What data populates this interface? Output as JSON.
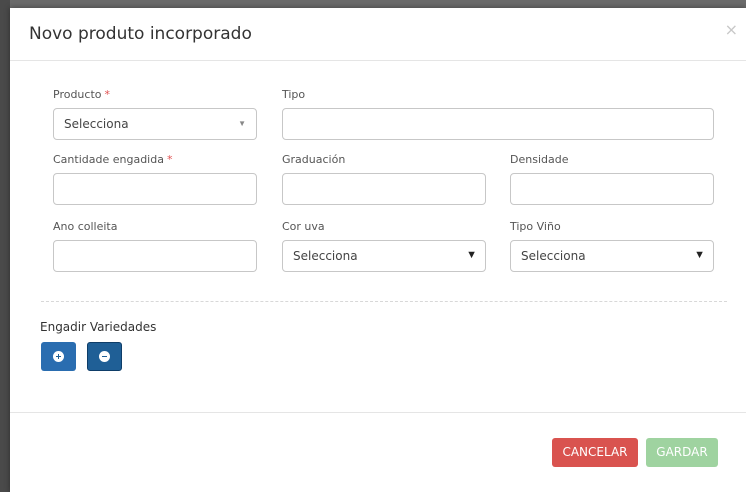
{
  "modal": {
    "title": "Novo produto incorporado",
    "close": "×"
  },
  "form": {
    "producto": {
      "label": "Producto",
      "required": "*",
      "value": "Selecciona",
      "caret": "▼"
    },
    "tipo": {
      "label": "Tipo",
      "value": ""
    },
    "cantidade": {
      "label": "Cantidade engadida",
      "required": "*",
      "value": ""
    },
    "graduacion": {
      "label": "Graduación",
      "value": ""
    },
    "densidade": {
      "label": "Densidade",
      "value": ""
    },
    "ano_colleita": {
      "label": "Ano colleita",
      "value": ""
    },
    "cor_uva": {
      "label": "Cor uva",
      "value": "Selecciona",
      "caret": "▼"
    },
    "tipo_vino": {
      "label": "Tipo Viño",
      "value": "Selecciona",
      "caret": "▼"
    }
  },
  "varieties": {
    "label": "Engadir Variedades",
    "add_icon": "plus-circle-icon",
    "remove_icon": "minus-circle-icon"
  },
  "footer": {
    "cancel_label": "CANCELAR",
    "save_label": "GARDAR"
  },
  "colors": {
    "primary": "#1f5f96",
    "danger": "#d9534f",
    "success_disabled": "#9fd3a0"
  }
}
